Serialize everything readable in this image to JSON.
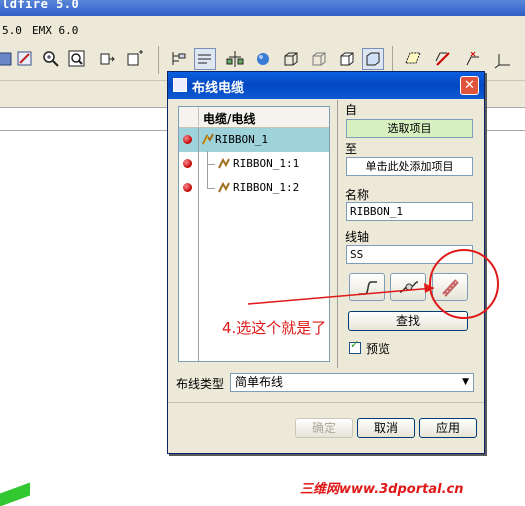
{
  "app": {
    "window_title": "ldfire 5.0",
    "menu_items": [
      "5.0",
      "EMX 6.0"
    ]
  },
  "dialog": {
    "title": "布线电缆",
    "close_glyph": "✕",
    "tree": {
      "header": "电缆/电线",
      "rows": [
        {
          "label": "RIBBON_1",
          "selected": true
        },
        {
          "label": "RIBBON_1:1",
          "selected": false
        },
        {
          "label": "RIBBON_1:2",
          "selected": false
        }
      ]
    },
    "from_label": "自",
    "from_value": "选取项目",
    "to_label": "至",
    "to_value": "单击此处添加项目",
    "name_label": "名称",
    "name_value": "RIBBON_1",
    "axis_label": "线轴",
    "axis_value": "SS",
    "find_button": "查找",
    "preview_label": "预览",
    "preview_checked": true,
    "route_type_label": "布线类型",
    "route_type_value": "简单布线",
    "ok_button": "确定",
    "cancel_button": "取消",
    "apply_button": "应用"
  },
  "annotation": {
    "text": "4.选这个就是了",
    "color": "#e01818"
  },
  "watermark": "三维网www.3dportal.cn",
  "colors": {
    "title_blue": "#0348c0",
    "selection": "#9fd3dc",
    "from_field": "#d8f0c0",
    "close_red": "#e0533d"
  }
}
